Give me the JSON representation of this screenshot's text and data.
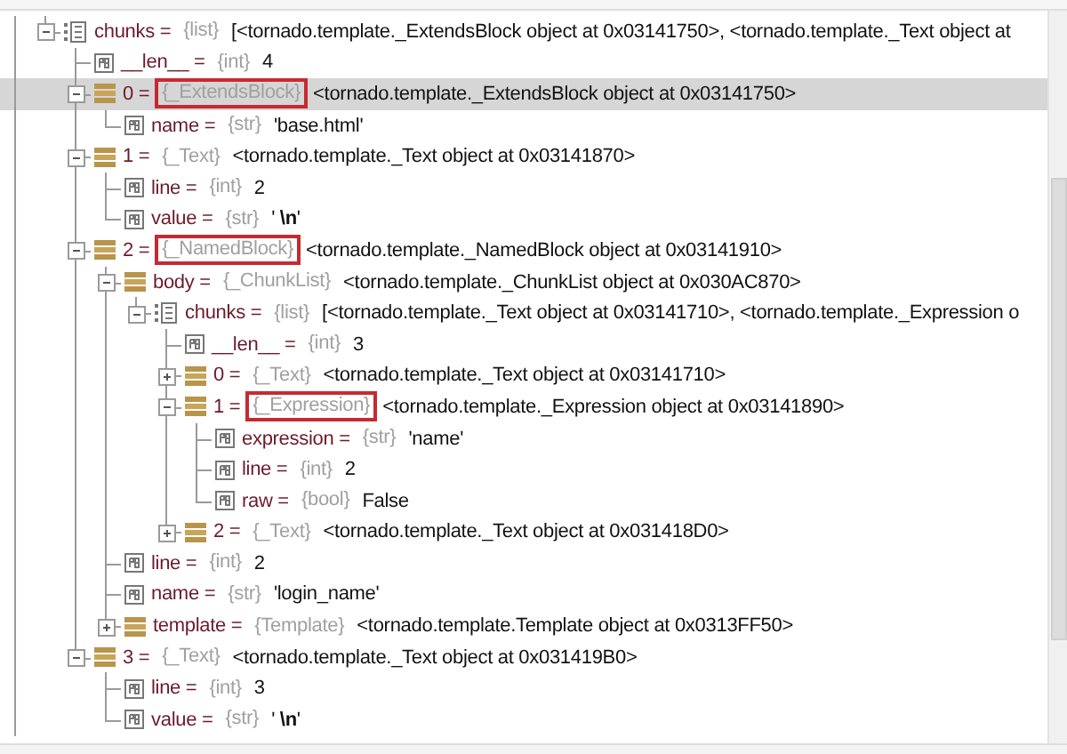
{
  "variables": {
    "tree": [
      {
        "kind": "list",
        "label": "chunks =",
        "type": "{list}",
        "value": "[<tornado.template._ExtendsBlock object at 0x03141750>, <tornado.template._Text object at",
        "expanded": true,
        "selected": false,
        "boxed": false,
        "children": [
          {
            "kind": "field",
            "label": "__len__ =",
            "type": "{int}",
            "value": "4",
            "selected": false,
            "boxed": false
          },
          {
            "kind": "object",
            "label": "0 =",
            "type": "{_ExtendsBlock}",
            "value": "<tornado.template._ExtendsBlock object at 0x03141750>",
            "expanded": true,
            "selected": true,
            "boxed": true,
            "children": [
              {
                "kind": "field",
                "label": "name =",
                "type": "{str}",
                "value": "'base.html'",
                "selected": false,
                "boxed": false
              }
            ]
          },
          {
            "kind": "object",
            "label": "1 =",
            "type": "{_Text}",
            "value": "<tornado.template._Text object at 0x03141870>",
            "expanded": true,
            "selected": false,
            "boxed": false,
            "children": [
              {
                "kind": "field",
                "label": "line =",
                "type": "{int}",
                "value": "2",
                "selected": false,
                "boxed": false
              },
              {
                "kind": "field",
                "label": "value =",
                "type": "{str}",
                "value": "' **\\n**'",
                "selected": false,
                "boxed": false
              }
            ]
          },
          {
            "kind": "object",
            "label": "2 =",
            "type": "{_NamedBlock}",
            "value": "<tornado.template._NamedBlock object at 0x03141910>",
            "expanded": true,
            "selected": false,
            "boxed": true,
            "children": [
              {
                "kind": "object",
                "label": "body =",
                "type": "{_ChunkList}",
                "value": "<tornado.template._ChunkList object at 0x030AC870>",
                "expanded": true,
                "selected": false,
                "boxed": false,
                "children": [
                  {
                    "kind": "list",
                    "label": "chunks =",
                    "type": "{list}",
                    "value": "[<tornado.template._Text object at 0x03141710>, <tornado.template._Expression o",
                    "expanded": true,
                    "selected": false,
                    "boxed": false,
                    "children": [
                      {
                        "kind": "field",
                        "label": "__len__ =",
                        "type": "{int}",
                        "value": "3",
                        "selected": false,
                        "boxed": false
                      },
                      {
                        "kind": "object",
                        "label": "0 =",
                        "type": "{_Text}",
                        "value": "<tornado.template._Text object at 0x03141710>",
                        "expanded": false,
                        "selected": false,
                        "boxed": false
                      },
                      {
                        "kind": "object",
                        "label": "1 =",
                        "type": "{_Expression}",
                        "value": "<tornado.template._Expression object at 0x03141890>",
                        "expanded": true,
                        "selected": false,
                        "boxed": true,
                        "children": [
                          {
                            "kind": "field",
                            "label": "expression =",
                            "type": "{str}",
                            "value": "'name'",
                            "selected": false,
                            "boxed": false
                          },
                          {
                            "kind": "field",
                            "label": "line =",
                            "type": "{int}",
                            "value": "2",
                            "selected": false,
                            "boxed": false
                          },
                          {
                            "kind": "field",
                            "label": "raw =",
                            "type": "{bool}",
                            "value": "False",
                            "selected": false,
                            "boxed": false
                          }
                        ]
                      },
                      {
                        "kind": "object",
                        "label": "2 =",
                        "type": "{_Text}",
                        "value": "<tornado.template._Text object at 0x031418D0>",
                        "expanded": false,
                        "selected": false,
                        "boxed": false
                      }
                    ]
                  }
                ]
              },
              {
                "kind": "field",
                "label": "line =",
                "type": "{int}",
                "value": "2",
                "selected": false,
                "boxed": false
              },
              {
                "kind": "field",
                "label": "name =",
                "type": "{str}",
                "value": "'login_name'",
                "selected": false,
                "boxed": false
              },
              {
                "kind": "object",
                "label": "template =",
                "type": "{Template}",
                "value": "<tornado.template.Template object at 0x0313FF50>",
                "expanded": false,
                "selected": false,
                "boxed": false
              }
            ]
          },
          {
            "kind": "object",
            "label": "3 =",
            "type": "{_Text}",
            "value": "<tornado.template._Text object at 0x031419B0>",
            "expanded": true,
            "selected": false,
            "boxed": false,
            "children": [
              {
                "kind": "field",
                "label": "line =",
                "type": "{int}",
                "value": "3",
                "selected": false,
                "boxed": false
              },
              {
                "kind": "field",
                "label": "value =",
                "type": "{str}",
                "value": "' **\\n**'",
                "selected": false,
                "boxed": false
              }
            ]
          }
        ]
      }
    ]
  }
}
